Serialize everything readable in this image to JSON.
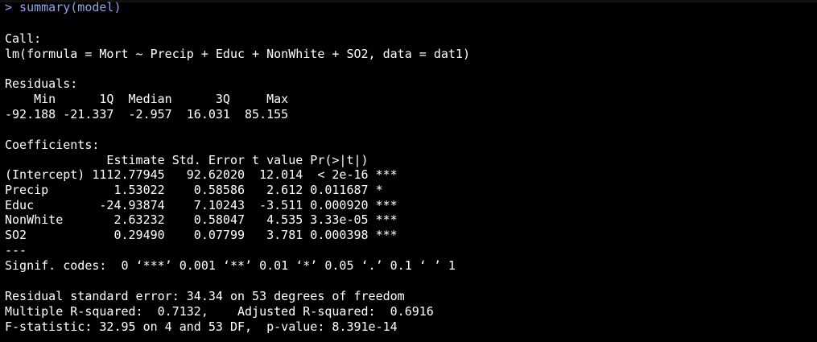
{
  "console": {
    "command_line": "> summary(model)",
    "output_lines": [
      "",
      "Call:",
      "lm(formula = Mort ~ Precip + Educ + NonWhite + SO2, data = dat1)",
      "",
      "Residuals:",
      "    Min      1Q  Median      3Q     Max ",
      "-92.188 -21.337  -2.957  16.031  85.155 ",
      "",
      "Coefficients:",
      "              Estimate Std. Error t value Pr(>|t|)    ",
      "(Intercept) 1112.77945   92.62020  12.014  < 2e-16 ***",
      "Precip         1.53022    0.58586   2.612 0.011687 *  ",
      "Educ         -24.93874    7.10243  -3.511 0.000920 ***",
      "NonWhite       2.63232    0.58047   4.535 3.33e-05 ***",
      "SO2            0.29490    0.07799   3.781 0.000398 ***",
      "---",
      "Signif. codes:  0 ‘***’ 0.001 ‘**’ 0.01 ‘*’ 0.05 ‘.’ 0.1 ‘ ’ 1",
      "",
      "Residual standard error: 34.34 on 53 degrees of freedom",
      "Multiple R-squared:  0.7132,\tAdjusted R-squared:  0.6916 ",
      "F-statistic: 32.95 on 4 and 53 DF,  p-value: 8.391e-14"
    ]
  },
  "colors": {
    "background": "#000000",
    "output_text": "#ffffff",
    "command_text": "#8ea6e8"
  }
}
